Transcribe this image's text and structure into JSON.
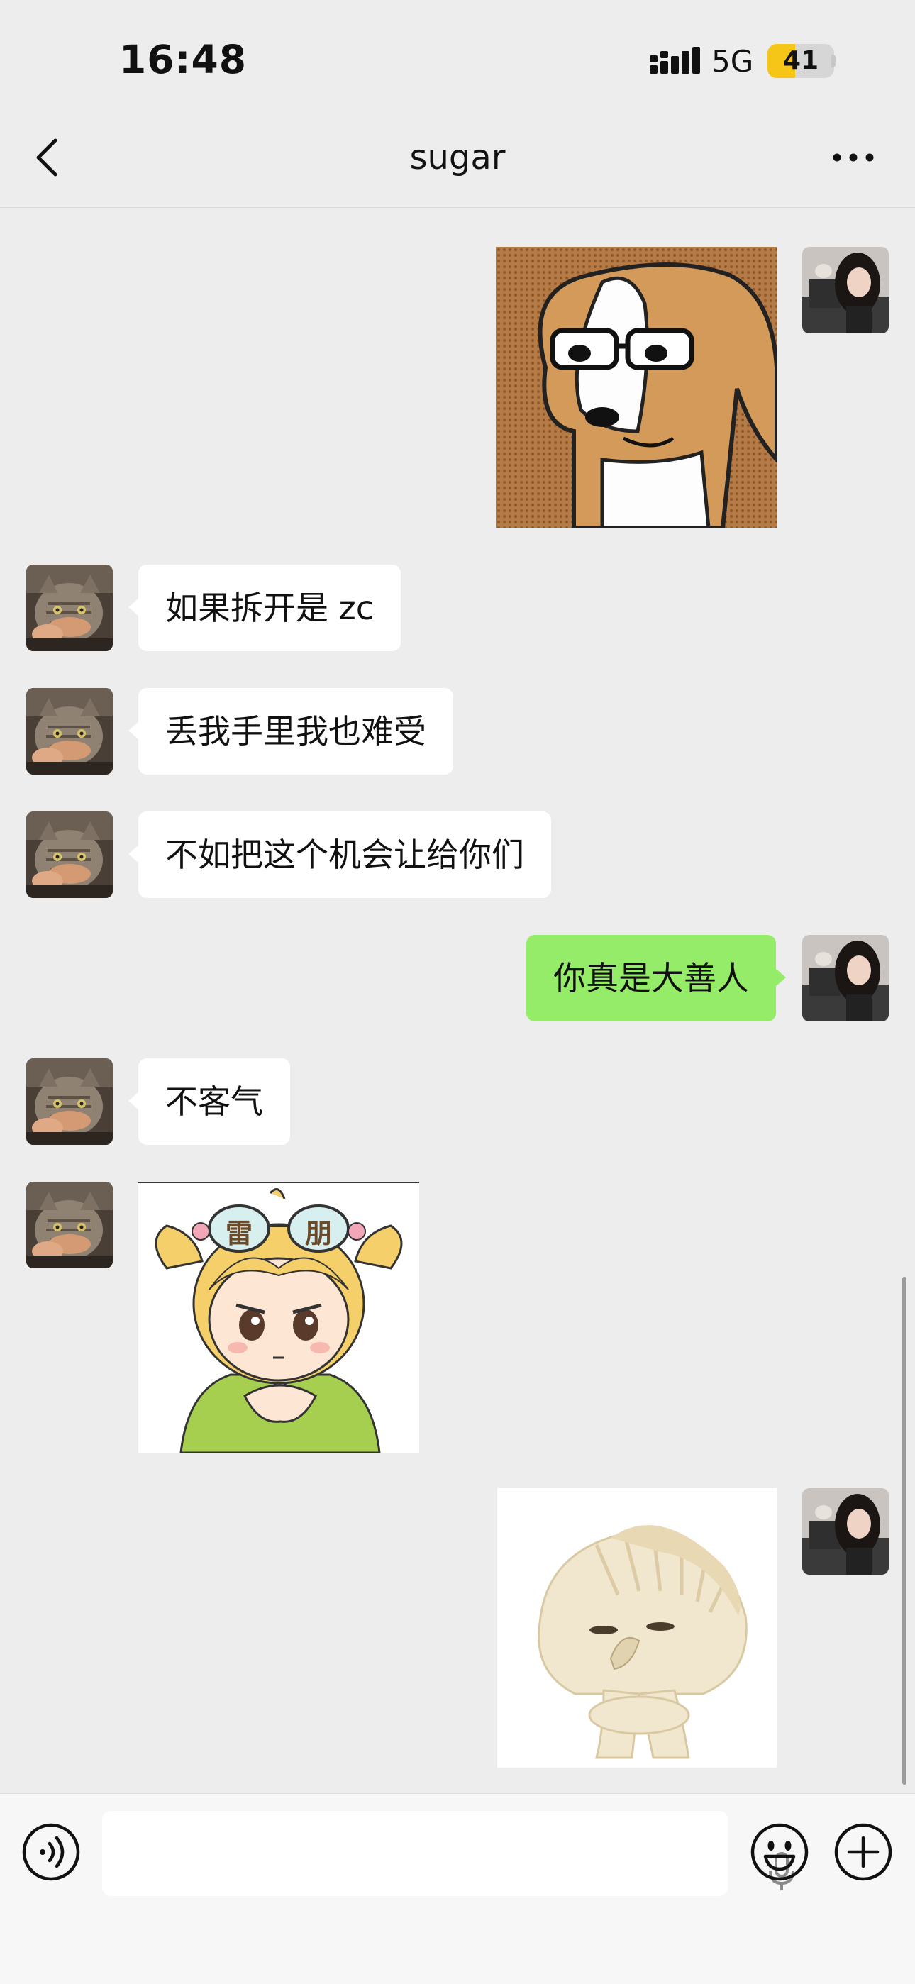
{
  "status_bar": {
    "time": "16:48",
    "network": "5G",
    "battery_level": "41",
    "battery_fraction": 0.41
  },
  "nav": {
    "title": "sugar",
    "back_icon": "chevron-left-icon",
    "more_icon": "more-dots-icon"
  },
  "messages": [
    {
      "sender": "self",
      "type": "sticker",
      "description_icon": "beagle-dog-sticker"
    },
    {
      "sender": "other",
      "type": "text",
      "text": "如果拆开是 zc"
    },
    {
      "sender": "other",
      "type": "text",
      "text": "丢我手里我也难受"
    },
    {
      "sender": "other",
      "type": "text",
      "text": "不如把这个机会让给你们"
    },
    {
      "sender": "self",
      "type": "text",
      "text": "你真是大善人"
    },
    {
      "sender": "other",
      "type": "text",
      "text": "不客气"
    },
    {
      "sender": "other",
      "type": "sticker",
      "glasses_text_left": "雷",
      "glasses_text_right": "朋"
    },
    {
      "sender": "self",
      "type": "sticker",
      "description_icon": "dumpling-sticker"
    }
  ],
  "input_bar": {
    "voice_icon": "voice-icon",
    "mic_icon": "mic-icon",
    "emoji_icon": "emoji-icon",
    "plus_icon": "plus-icon"
  },
  "colors": {
    "background": "#ededed",
    "outgoing_bubble": "#95ec69",
    "incoming_bubble": "#ffffff",
    "battery": "#f5c518"
  }
}
